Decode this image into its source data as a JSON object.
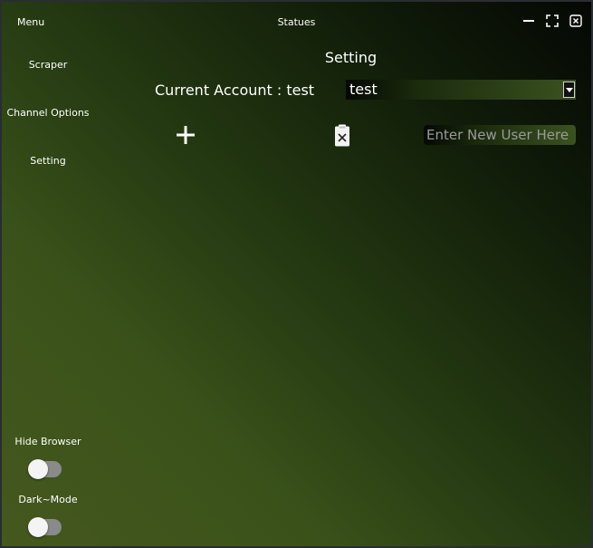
{
  "title_bar": {
    "menu_label": "Menu",
    "title": "Statues",
    "controls": [
      "minimize-icon",
      "maximize-icon",
      "close-icon"
    ]
  },
  "sidebar": {
    "items": [
      {
        "label": "Scraper"
      },
      {
        "label": "Channel Options"
      },
      {
        "label": "Setting"
      }
    ],
    "toggles": [
      {
        "label": "Hide Browser",
        "on": false
      },
      {
        "label": "Dark~Mode",
        "on": false
      }
    ]
  },
  "settings": {
    "title": "Setting",
    "current_account_label": "Current Account : test",
    "account_select_value": "test",
    "add_icon": "plus-icon",
    "delete_icon": "clipboard-delete-icon",
    "new_user_placeholder": "Enter New User Here"
  },
  "colors": {
    "background_dark": "#050805",
    "background_olive": "#45581e",
    "toggle_track": "#8a8a8a",
    "toggle_knob": "#f4f4f4",
    "text": "#ffffff"
  }
}
